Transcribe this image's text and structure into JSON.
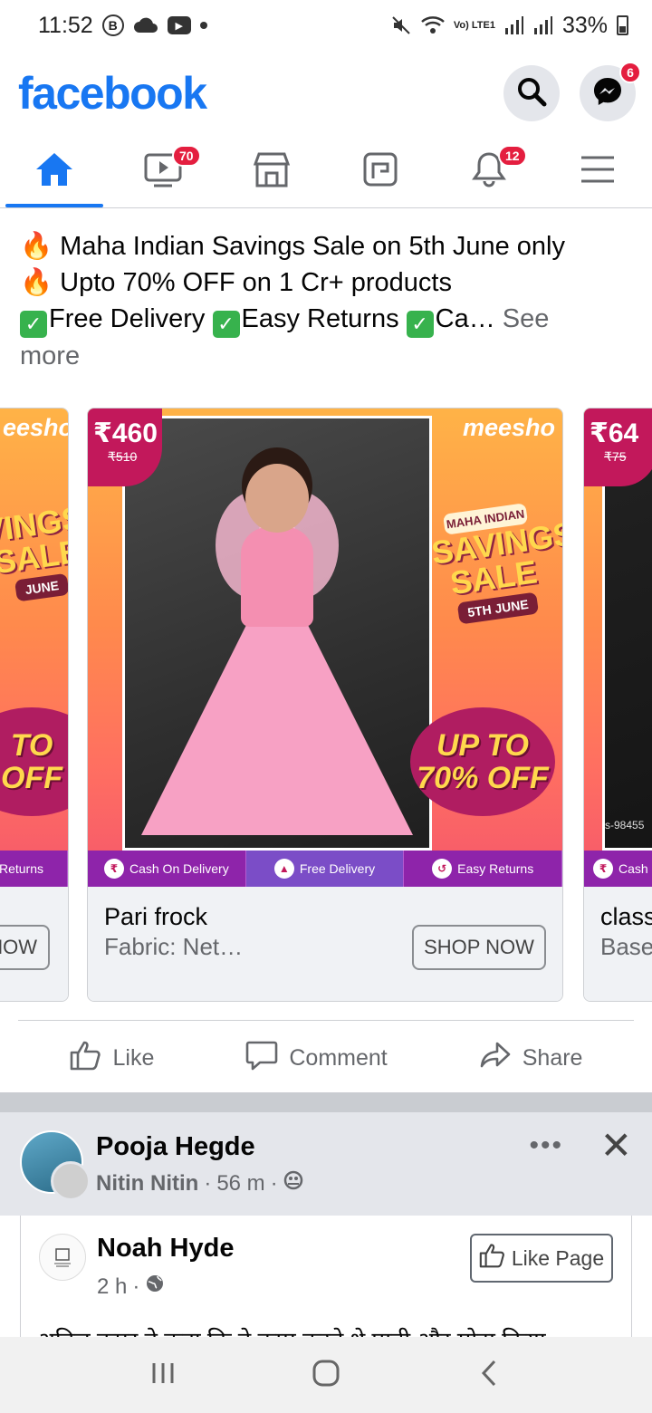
{
  "status_bar": {
    "time": "11:52",
    "icons": [
      "b-circle-icon",
      "cloud-icon",
      "youtube-icon",
      "dot-icon"
    ],
    "network": "Vo) LTE1",
    "battery": "33%"
  },
  "header": {
    "logo": "facebook",
    "messenger_badge": "6"
  },
  "nav_tabs": [
    {
      "name": "home",
      "badge": ""
    },
    {
      "name": "watch",
      "badge": "70"
    },
    {
      "name": "marketplace",
      "badge": ""
    },
    {
      "name": "news",
      "badge": ""
    },
    {
      "name": "notifications",
      "badge": "12"
    },
    {
      "name": "menu",
      "badge": ""
    }
  ],
  "post": {
    "lines": [
      "Maha Indian Savings Sale on 5th June only",
      "Upto 70% OFF on 1 Cr+ products"
    ],
    "check_items": [
      "Free Delivery ",
      "Easy Returns ",
      "Ca…"
    ],
    "see_more": "See",
    "more": "more"
  },
  "carousel": {
    "strip_labels": [
      "Cash On Delivery",
      "Free Delivery",
      "Easy Returns"
    ],
    "left_card": {
      "brand": "eesho",
      "strip_label": "Returns",
      "button": "NOW",
      "sale_text": "VINGS SALE",
      "date": "JUNE",
      "off_line1": "TO",
      "off_line2": "OFF"
    },
    "main_card": {
      "price": "₹460",
      "old_price": "₹510",
      "brand": "meesho",
      "sale_top": "MAHA INDIAN",
      "sale_big": "SAVINGS SALE",
      "sale_date": "5TH JUNE",
      "off_line1": "UP TO",
      "off_line2": "70% OFF",
      "title": "Pari frock",
      "subtitle": "Fabric: Net…",
      "button": "SHOP NOW"
    },
    "right_card": {
      "price": "₹64",
      "old_price": "₹75",
      "code": "s-98455",
      "strip_label": "Cash",
      "title": "class",
      "subtitle": "Base"
    }
  },
  "actions": {
    "like": "Like",
    "comment": "Comment",
    "share": "Share"
  },
  "post2": {
    "name": "Pooja Hegde",
    "via": "Nitin Nitin",
    "time": "56 m",
    "dots": "•••"
  },
  "shared": {
    "name": "Noah Hyde",
    "time": "2 h",
    "like_page": "Like Page",
    "cut_text": "अनिल कपूर ने कहा कि वे काम करते थे पानी और मोटा किया"
  }
}
